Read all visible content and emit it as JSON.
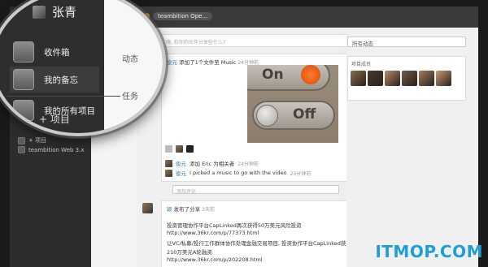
{
  "app": {
    "user_name": "张青",
    "project_title": "teambition Ope...",
    "top_left_label": "on"
  },
  "sidebar": {
    "items": [
      {
        "label": "收件箱"
      },
      {
        "label": "我的备忘"
      },
      {
        "label": "我的所有项目"
      },
      {
        "label": "+ 项目"
      },
      {
        "label": "teambition Web 3.x"
      }
    ]
  },
  "column_tabs": {
    "activity": "动态",
    "tasks": "任务"
  },
  "feed": {
    "composer_placeholder": "嗨, 和你的伙伴分享些什么?",
    "post1": {
      "author": "俊元",
      "action": "添加了1个文件至 Music",
      "time": "24分钟前",
      "switch_on_label": "On",
      "switch_off_label": "Off",
      "comments": [
        {
          "author": "俊元",
          "text": "添加 Eric 为相关者",
          "time": "24分钟前"
        },
        {
          "author": "俊元",
          "text": "I picked a music to go with the video",
          "time": "23分钟前"
        }
      ],
      "comment_placeholder": "添加评论",
      "more_label": "•••"
    },
    "post2": {
      "author": "颖",
      "action": "发布了分享",
      "time": "3天前",
      "lines": [
        "投资管理协作平台CapLinked再次获得50万美元风险投资",
        "http://www.36kr.com/p/77373.html",
        "让VC/私募/投行工作群体协作处理金融交易项目, 投资协作平台CapLinked获",
        "210万美元A轮融资",
        "http://www.36kr.com/p/202208.html"
      ]
    }
  },
  "right_panel": {
    "filter_select": "所有动态",
    "members_title": "项目成员",
    "member_colors": [
      "#8a6d4f",
      "#4a3a2e",
      "#b98a6e",
      "#6f5b4a",
      "#a57c5f",
      "#c89a7a"
    ]
  },
  "watermark": {
    "text": "ITMOP.COM"
  }
}
